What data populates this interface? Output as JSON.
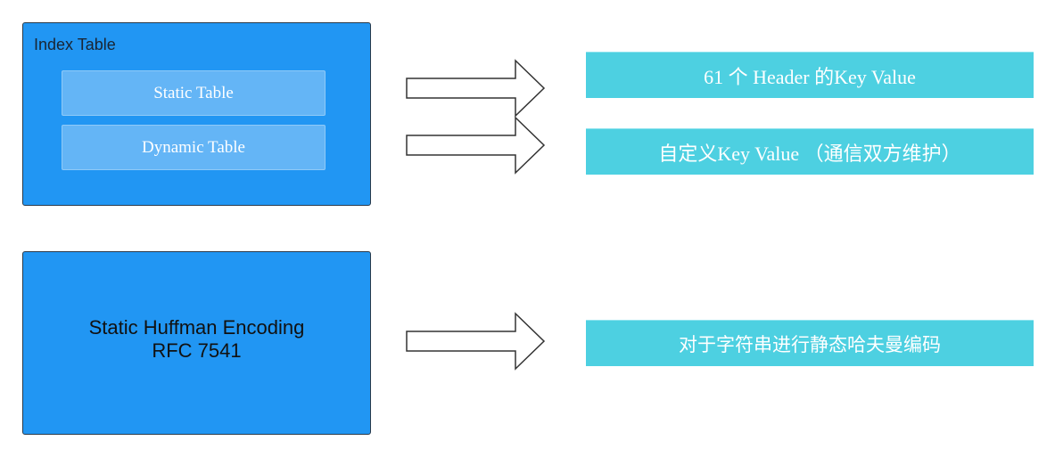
{
  "index_table": {
    "title": "Index Table",
    "static_table_label": "Static Table",
    "dynamic_table_label": "Dynamic Table"
  },
  "huffman": {
    "line1": "Static Huffman Encoding",
    "line2": "RFC 7541"
  },
  "results": {
    "static": "61 个 Header 的Key Value",
    "dynamic": "自定义Key Value （通信双方维护）",
    "huffman": "对于字符串进行静态哈夫曼编码"
  },
  "colors": {
    "panel_blue": "#2196f3",
    "inner_box_blue": "#64b5f6",
    "result_cyan": "#4dd0e1",
    "arrow_stroke": "#333333"
  }
}
